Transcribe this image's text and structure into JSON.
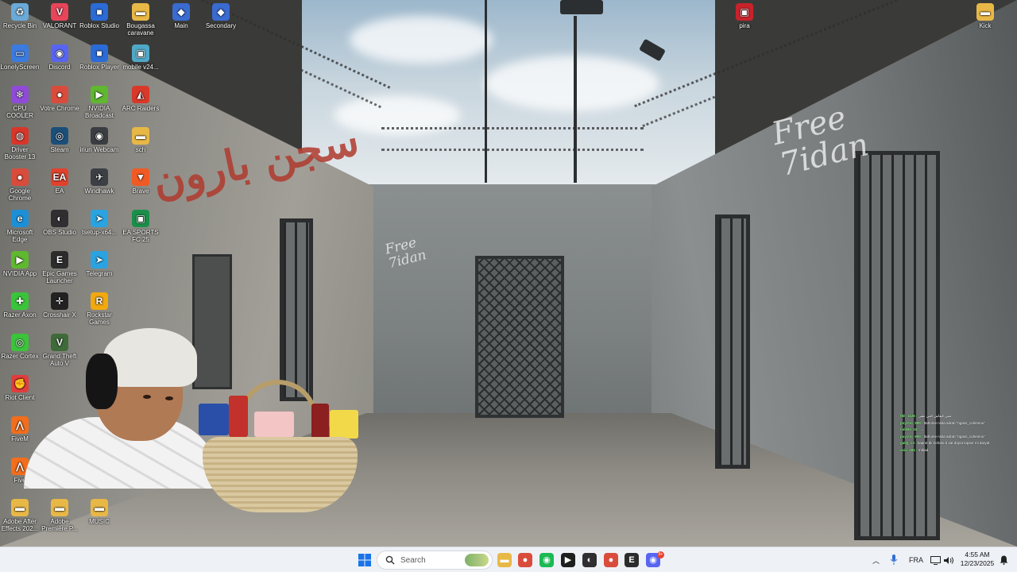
{
  "desktop": {
    "icons": [
      {
        "label": "Recycle Bin",
        "glyph": "♻",
        "color": "#6aa9d8"
      },
      {
        "label": "VALORANT",
        "glyph": "V",
        "color": "#e8455a"
      },
      {
        "label": "Roblox Studio",
        "glyph": "■",
        "color": "#2b6bd6"
      },
      {
        "label": "Bougassa caravane",
        "glyph": "▬",
        "color": "#e8b847"
      },
      {
        "label": "Main",
        "glyph": "◆",
        "color": "#3a6bd0"
      },
      {
        "label": "Secondary",
        "glyph": "◆",
        "color": "#3a6bd0"
      },
      {
        "label": "LonelyScreen",
        "glyph": "▭",
        "color": "#3b7be0"
      },
      {
        "label": "Discord",
        "glyph": "◉",
        "color": "#5865f2"
      },
      {
        "label": "Roblox Player",
        "glyph": "■",
        "color": "#2b6bd6"
      },
      {
        "label": "mobile v24...",
        "glyph": "▣",
        "color": "#4fa8c7"
      },
      {
        "label": "CPU COOLER V4.0",
        "glyph": "❄",
        "color": "#8f4bd8"
      },
      {
        "label": "Votre Chrome",
        "glyph": "●",
        "color": "#d94c3c"
      },
      {
        "label": "NVIDIA Broadcast",
        "glyph": "▶",
        "color": "#5fb82f"
      },
      {
        "label": "ARC Raiders",
        "glyph": "◭",
        "color": "#d8392a"
      },
      {
        "label": "Driver Booster 13",
        "glyph": "◍",
        "color": "#d8362a"
      },
      {
        "label": "Steam",
        "glyph": "◎",
        "color": "#1b4f7a"
      },
      {
        "label": "iriun Webcam",
        "glyph": "◉",
        "color": "#3a3d41"
      },
      {
        "label": "sch",
        "glyph": "▬",
        "color": "#e8b847"
      },
      {
        "label": "Google Chrome",
        "glyph": "●",
        "color": "#d94c3c"
      },
      {
        "label": "EA",
        "glyph": "EA",
        "color": "#e2422d"
      },
      {
        "label": "Windhawk",
        "glyph": "✈",
        "color": "#3c3f44"
      },
      {
        "label": "Brave",
        "glyph": "▼",
        "color": "#f05a24"
      },
      {
        "label": "Microsoft Edge",
        "glyph": "e",
        "color": "#1d8fd6"
      },
      {
        "label": "OBS Studio",
        "glyph": "◐",
        "color": "#302e31"
      },
      {
        "label": "tsetup-x64...",
        "glyph": "➤",
        "color": "#2aa3e0"
      },
      {
        "label": "EA SPORTS FC 25",
        "glyph": "▣",
        "color": "#1a8f49"
      },
      {
        "label": "NVIDIA App",
        "glyph": "▶",
        "color": "#5fb82f"
      },
      {
        "label": "Epic Games Launcher",
        "glyph": "E",
        "color": "#2c2c2c"
      },
      {
        "label": "Telegram",
        "glyph": "➤",
        "color": "#2aa3e0"
      },
      {
        "label": "Razer Axon",
        "glyph": "✚",
        "color": "#3ac43a"
      },
      {
        "label": "Crosshair X",
        "glyph": "✛",
        "color": "#222222"
      },
      {
        "label": "Rockstar Games",
        "glyph": "R",
        "color": "#f2a90f"
      },
      {
        "label": "Razer Cortex",
        "glyph": "◎",
        "color": "#3ac43a"
      },
      {
        "label": "Grand Theft Auto V",
        "glyph": "V",
        "color": "#3f6b3a"
      },
      {
        "label": "Riot Client",
        "glyph": "✊",
        "color": "#e23d3d"
      },
      {
        "label": "FiveM",
        "glyph": "⋀",
        "color": "#f26e1c"
      },
      {
        "label": "Five",
        "glyph": "⋀",
        "color": "#f26e1c"
      },
      {
        "label": "Adobe After Effects 202...",
        "glyph": "▬",
        "color": "#e8b847"
      },
      {
        "label": "Adobe Première P...",
        "glyph": "▬",
        "color": "#e8b847"
      },
      {
        "label": "MUSIC",
        "glyph": "▬",
        "color": "#e8b847"
      },
      {
        "label": "pira",
        "glyph": "▣",
        "color": "#c8232c"
      },
      {
        "label": "Kick",
        "glyph": "▬",
        "color": "#e8b847"
      }
    ]
  },
  "wallpaper": {
    "graffiti_red": "سجن بارون",
    "graffiti_white_1": "Free 7idan",
    "graffiti_white_2": "Free 7idan"
  },
  "chat": {
    "messages": [
      {
        "user": "f8il_1126 :",
        "text": "مش كيفاش كنتي تبقى"
      },
      {
        "user": "psycho_999 :",
        "text": "ttahome nsita adrari \"ngass_cuhemnu\""
      },
      {
        "user": "milk9s_18 :",
        "text": "..."
      },
      {
        "user": "psycho_999 :",
        "text": "ttahome nsita adrari \"ngass_cuhemnu\""
      },
      {
        "user": "gallg_x3 :",
        "text": "kaprot dir bchato b xat dayra lopaxr mi daryat"
      },
      {
        "user": "axia_484 :",
        "text": "rnibad"
      }
    ]
  },
  "taskbar": {
    "search_placeholder": "Search",
    "language": "FRA",
    "time": "4:55 AM",
    "date": "12/23/2025",
    "notification_badge": "9+",
    "pinned": [
      {
        "name": "file-explorer-icon",
        "glyph": "▬",
        "color": "#e8b847"
      },
      {
        "name": "chrome-icon",
        "glyph": "●",
        "color": "#d94c3c"
      },
      {
        "name": "spotify-icon",
        "glyph": "◉",
        "color": "#1db954"
      },
      {
        "name": "nvidia-icon",
        "glyph": "▶",
        "color": "#1f1f1f"
      },
      {
        "name": "obs-icon",
        "glyph": "◐",
        "color": "#302e31"
      },
      {
        "name": "chrome-icon-2",
        "glyph": "●",
        "color": "#d94c3c"
      },
      {
        "name": "epic-games-icon",
        "glyph": "E",
        "color": "#2c2c2c"
      },
      {
        "name": "discord-icon",
        "glyph": "◉",
        "color": "#5865f2"
      }
    ]
  }
}
